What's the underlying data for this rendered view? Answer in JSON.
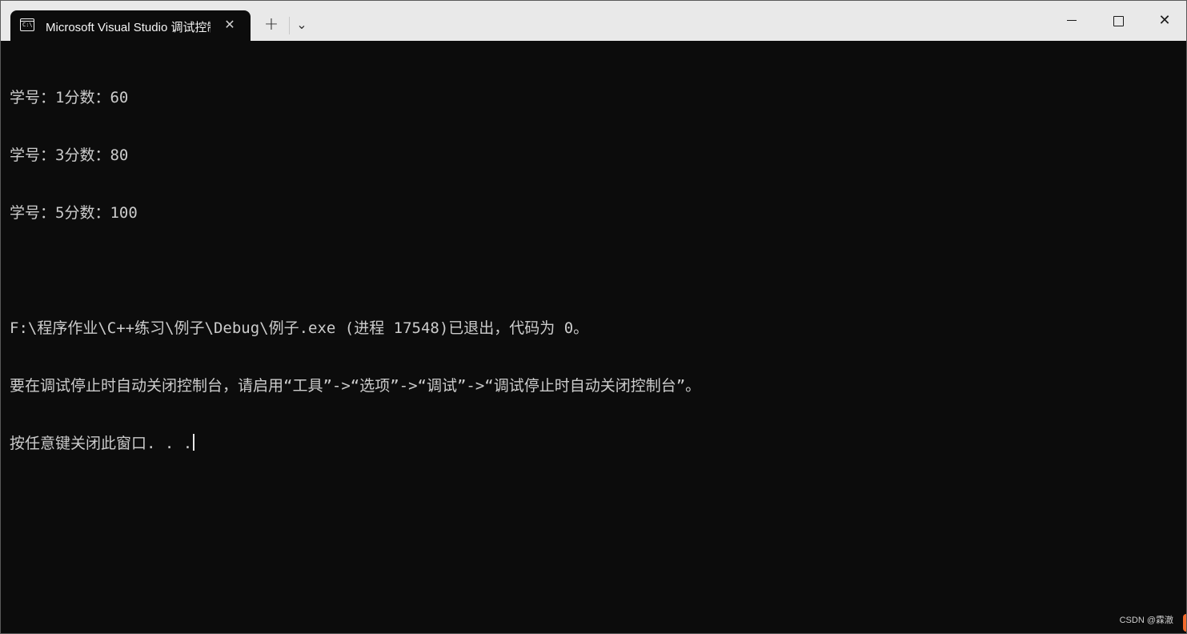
{
  "window": {
    "tab_title": "Microsoft Visual Studio 调试控制台",
    "tab_icon_text": "C:\\",
    "new_tab_label": "+",
    "dropdown_label": "⌄",
    "close_tab_label": "✕",
    "close_window_label": "✕"
  },
  "console": {
    "lines": [
      "学号：1分数：60",
      "学号：3分数：80",
      "学号：5分数：100",
      "",
      "F:\\程序作业\\C++练习\\例子\\Debug\\例子.exe (进程 17548)已退出，代码为 0。",
      "要在调试停止时自动关闭控制台，请启用“工具”->“选项”->“调试”->“调试停止时自动关闭控制台”。",
      "按任意键关闭此窗口. . ."
    ]
  },
  "watermark": {
    "text": "CSDN @霖澈"
  },
  "colors": {
    "titlebar_bg": "#e9e9e9",
    "console_bg": "#0c0c0c",
    "console_text": "#cccccc",
    "watermark_accent": "#f26b2e"
  }
}
